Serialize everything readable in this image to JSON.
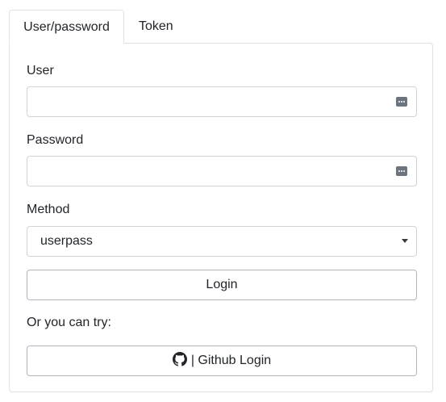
{
  "tabs": [
    {
      "label": "User/password",
      "active": true
    },
    {
      "label": "Token",
      "active": false
    }
  ],
  "form": {
    "user_label": "User",
    "user_value": "",
    "password_label": "Password",
    "password_value": "",
    "method_label": "Method",
    "method_selected": "userpass",
    "login_button": "Login",
    "alt_text": "Or you can try:",
    "github_button": "| Github Login"
  },
  "icons": {
    "password_manager": "password-manager-icon",
    "dropdown": "chevron-down-icon",
    "github": "github-icon"
  },
  "colors": {
    "border": "#ced4da",
    "button_border": "#adb5bd",
    "text": "#212529"
  }
}
